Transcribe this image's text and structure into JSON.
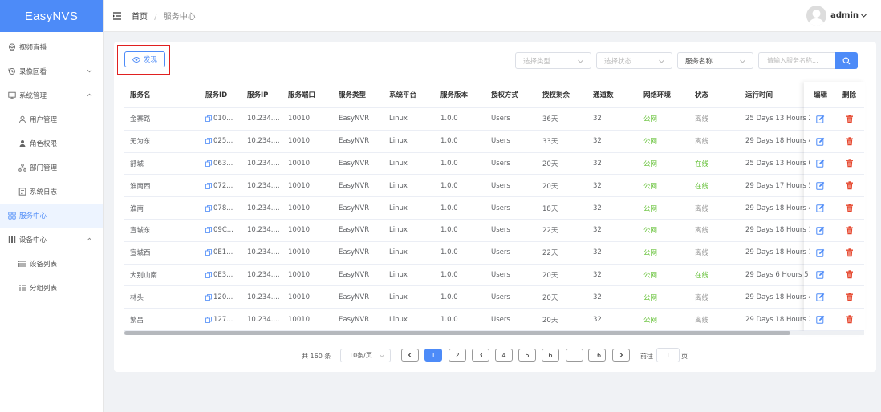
{
  "app": {
    "logo": "EasyNVS"
  },
  "header": {
    "breadcrumb_home": "首页",
    "breadcrumb_sep": "/",
    "breadcrumb_current": "服务中心",
    "username": "admin"
  },
  "sidebar": {
    "items": [
      {
        "label": "视频直播",
        "icon": "live-video-icon"
      },
      {
        "label": "录像回看",
        "icon": "playback-icon"
      },
      {
        "label": "系统管理",
        "icon": "system-icon"
      },
      {
        "label": "用户管理",
        "icon": "user-icon"
      },
      {
        "label": "角色权限",
        "icon": "role-icon"
      },
      {
        "label": "部门管理",
        "icon": "department-icon"
      },
      {
        "label": "系统日志",
        "icon": "log-icon"
      },
      {
        "label": "服务中心",
        "icon": "service-icon"
      },
      {
        "label": "设备中心",
        "icon": "device-icon"
      },
      {
        "label": "设备列表",
        "icon": "device-list-icon"
      },
      {
        "label": "分组列表",
        "icon": "group-list-icon"
      }
    ]
  },
  "toolbar": {
    "discover_label": "发现",
    "type_placeholder": "选择类型",
    "status_placeholder": "选择状态",
    "field_select": "服务名称",
    "search_placeholder": "请输入服务名称..."
  },
  "table": {
    "headers": [
      "服务名",
      "服务ID",
      "服务IP",
      "服务端口",
      "服务类型",
      "系统平台",
      "服务版本",
      "授权方式",
      "授权剩余",
      "通道数",
      "网络环境",
      "状态",
      "运行时间",
      "编辑",
      "删除"
    ],
    "rows": [
      [
        "金寨路",
        "010...",
        "10.234....",
        "10010",
        "EasyNVR",
        "Linux",
        "1.0.0",
        "Users",
        "36天",
        "32",
        "公网",
        "离线",
        "25 Days 13 Hours 2"
      ],
      [
        "无为东",
        "025...",
        "10.234....",
        "10010",
        "EasyNVR",
        "Linux",
        "1.0.0",
        "Users",
        "33天",
        "32",
        "公网",
        "离线",
        "29 Days 18 Hours 4"
      ],
      [
        "舒城",
        "063...",
        "10.234....",
        "10010",
        "EasyNVR",
        "Linux",
        "1.0.0",
        "Users",
        "20天",
        "32",
        "公网",
        "在线",
        "25 Days 13 Hours 0"
      ],
      [
        "淮南西",
        "072...",
        "10.234....",
        "10010",
        "EasyNVR",
        "Linux",
        "1.0.0",
        "Users",
        "20天",
        "32",
        "公网",
        "在线",
        "29 Days 17 Hours 5"
      ],
      [
        "淮南",
        "078...",
        "10.234....",
        "10010",
        "EasyNVR",
        "Linux",
        "1.0.0",
        "Users",
        "18天",
        "32",
        "公网",
        "离线",
        "29 Days 18 Hours 4"
      ],
      [
        "宣城东",
        "09C...",
        "10.234....",
        "10010",
        "EasyNVR",
        "Linux",
        "1.0.0",
        "Users",
        "22天",
        "32",
        "公网",
        "离线",
        "29 Days 18 Hours 1"
      ],
      [
        "宣城西",
        "0E1...",
        "10.234....",
        "10010",
        "EasyNVR",
        "Linux",
        "1.0.0",
        "Users",
        "22天",
        "32",
        "公网",
        "离线",
        "29 Days 18 Hours 1"
      ],
      [
        "大别山南",
        "0E3...",
        "10.234....",
        "10010",
        "EasyNVR",
        "Linux",
        "1.0.0",
        "Users",
        "20天",
        "32",
        "公网",
        "在线",
        "29 Days 6 Hours 5"
      ],
      [
        "林头",
        "120...",
        "10.234....",
        "10010",
        "EasyNVR",
        "Linux",
        "1.0.0",
        "Users",
        "20天",
        "32",
        "公网",
        "离线",
        "29 Days 18 Hours 4"
      ],
      [
        "繁昌",
        "127...",
        "10.234....",
        "10010",
        "EasyNVR",
        "Linux",
        "1.0.0",
        "Users",
        "20天",
        "32",
        "公网",
        "离线",
        "29 Days 18 Hours 2"
      ]
    ],
    "horizontal_scroll_fraction": 0.9
  },
  "pagination": {
    "total": "共 160 条",
    "page_size": "10条/页",
    "pages": [
      "1",
      "2",
      "3",
      "4",
      "5",
      "6",
      "...",
      "16"
    ],
    "current": "1",
    "goto_label": "前往",
    "goto_value": "1",
    "page_suffix": "页"
  },
  "colors": {
    "primary": "#4d8bf8",
    "online": "#67c23a",
    "offline": "#999999",
    "delete": "#e6472e",
    "highlight_border": "#e02020"
  }
}
